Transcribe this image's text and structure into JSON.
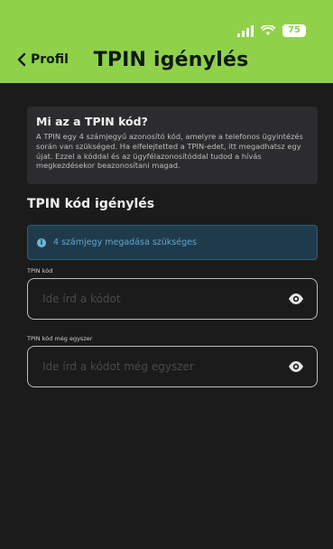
{
  "status_bar": {
    "battery": "75"
  },
  "header": {
    "back_label": "Profil",
    "title": "TPIN igénylés"
  },
  "info_card": {
    "title": "Mi az a TPIN kód?",
    "body": "A TPIN egy 4 számjegyű azonosító kód, amelyre a telefonos ügyintézés során van szükséged. Ha elfelejtetted a TPIN-edet, itt megadhatsz egy újat. Ezzel a kóddal és az ügyfélazonosítóddal tudod a hívás megkezdésekor beazonosítani magad."
  },
  "section": {
    "title": "TPIN kód igénylés"
  },
  "alert": {
    "text": "4 számjegy megadása szükséges"
  },
  "fields": [
    {
      "label": "TPIN kód",
      "placeholder": "Ide írd a kódot",
      "value": ""
    },
    {
      "label": "TPIN kód még egyszer",
      "placeholder": "Ide írd a kódot még egyszer",
      "value": ""
    }
  ],
  "colors": {
    "header_green": "#8fd24a",
    "background": "#1b1b1c",
    "card": "#2c2c2e",
    "alert_bg": "#1f3b4b",
    "alert_text": "#5ea7d1"
  }
}
